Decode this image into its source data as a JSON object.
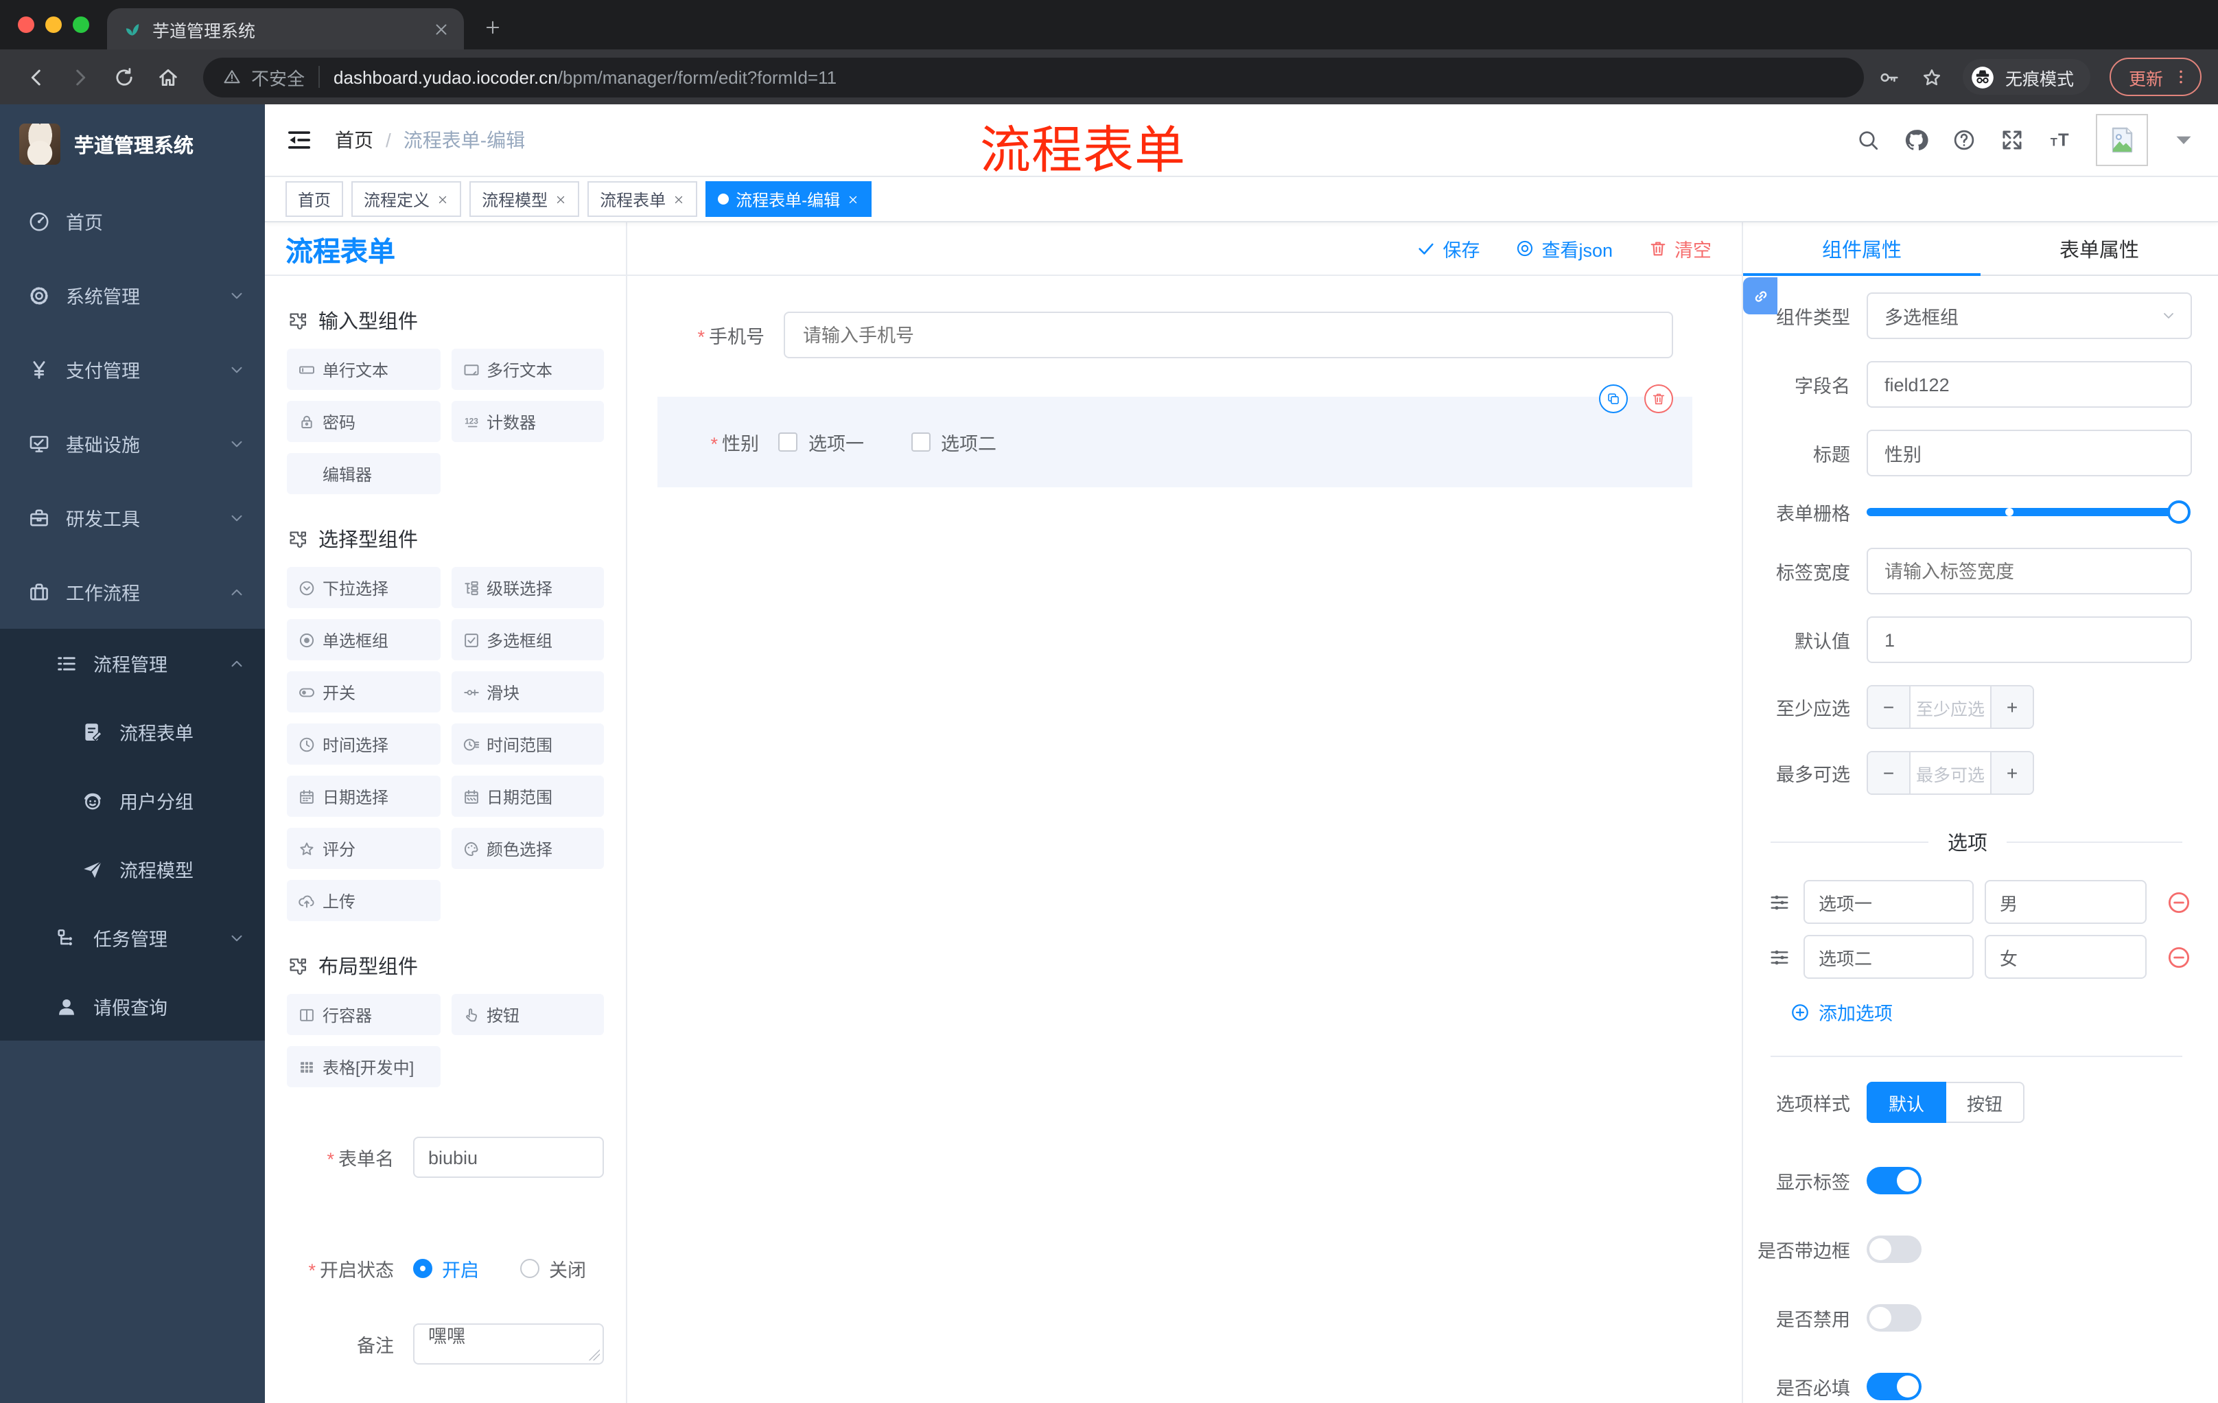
{
  "misc": {
    "asterisk": "*",
    "minus": "−",
    "plus": "+"
  },
  "colors": {
    "accent": "#0e8aff",
    "danger": "#f56c6c",
    "sidebar_bg": "#304156",
    "submenu_bg": "#1f2d3d",
    "annotation_red": "#fe2c0c",
    "active_tag": "#0e8aff"
  },
  "browser": {
    "tab_title": "芋道管理系统",
    "security": "不安全",
    "host": "dashboard.yudao.iocoder.cn",
    "path": "/bpm/manager/form/edit?formId=11",
    "incognito": "无痕模式",
    "update": "更新"
  },
  "sidebar": {
    "logo_title": "芋道管理系统",
    "items": [
      {
        "label": "首页",
        "icon": "dashboard-icon",
        "level": 1,
        "chevron": "",
        "sub": false
      },
      {
        "label": "系统管理",
        "icon": "gear-icon",
        "level": 1,
        "chevron": "down",
        "sub": false
      },
      {
        "label": "支付管理",
        "icon": "yen-icon",
        "level": 1,
        "chevron": "down",
        "sub": false
      },
      {
        "label": "基础设施",
        "icon": "monitor-icon",
        "level": 1,
        "chevron": "down",
        "sub": false
      },
      {
        "label": "研发工具",
        "icon": "briefcase-icon",
        "level": 1,
        "chevron": "down",
        "sub": false
      },
      {
        "label": "工作流程",
        "icon": "suitcase-icon",
        "level": 1,
        "chevron": "up",
        "sub": false
      },
      {
        "label": "流程管理",
        "icon": "list-icon",
        "level": 2,
        "chevron": "up",
        "sub": true
      },
      {
        "label": "流程表单",
        "icon": "doc-edit-icon",
        "level": 3,
        "chevron": "",
        "sub": true
      },
      {
        "label": "用户分组",
        "icon": "robot-icon",
        "level": 3,
        "chevron": "",
        "sub": true
      },
      {
        "label": "流程模型",
        "icon": "plane-icon",
        "level": 3,
        "chevron": "",
        "sub": true
      },
      {
        "label": "任务管理",
        "icon": "org-icon",
        "level": 2,
        "chevron": "down",
        "sub": true
      },
      {
        "label": "请假查询",
        "icon": "person-icon",
        "level": 2,
        "chevron": "",
        "sub": true
      }
    ]
  },
  "header": {
    "breadcrumb_home": "首页",
    "breadcrumb_sep": "/",
    "breadcrumb_current": "流程表单-编辑",
    "annotation": "流程表单"
  },
  "tags": [
    {
      "label": "首页",
      "closable": false,
      "active": false
    },
    {
      "label": "流程定义",
      "closable": true,
      "active": false
    },
    {
      "label": "流程模型",
      "closable": true,
      "active": false
    },
    {
      "label": "流程表单",
      "closable": true,
      "active": false
    },
    {
      "label": "流程表单-编辑",
      "closable": true,
      "active": true
    }
  ],
  "palette": {
    "title": "流程表单",
    "sections": [
      {
        "title": "输入型组件",
        "items": [
          {
            "label": "单行文本",
            "icon": "input-icon"
          },
          {
            "label": "多行文本",
            "icon": "textarea-icon"
          },
          {
            "label": "密码",
            "icon": "lock-icon"
          },
          {
            "label": "计数器",
            "icon": "counter-icon"
          },
          {
            "label": "编辑器",
            "icon": ""
          }
        ]
      },
      {
        "title": "选择型组件",
        "items": [
          {
            "label": "下拉选择",
            "icon": "select-icon"
          },
          {
            "label": "级联选择",
            "icon": "cascade-icon"
          },
          {
            "label": "单选框组",
            "icon": "radio-icon"
          },
          {
            "label": "多选框组",
            "icon": "checkbox-icon"
          },
          {
            "label": "开关",
            "icon": "switch-icon"
          },
          {
            "label": "滑块",
            "icon": "slider-icon"
          },
          {
            "label": "时间选择",
            "icon": "time-icon"
          },
          {
            "label": "时间范围",
            "icon": "time-range-icon"
          },
          {
            "label": "日期选择",
            "icon": "date-icon"
          },
          {
            "label": "日期范围",
            "icon": "date-range-icon"
          },
          {
            "label": "评分",
            "icon": "star-icon"
          },
          {
            "label": "颜色选择",
            "icon": "color-icon"
          },
          {
            "label": "上传",
            "icon": "upload-icon"
          }
        ]
      },
      {
        "title": "布局型组件",
        "items": [
          {
            "label": "行容器",
            "icon": "row-icon"
          },
          {
            "label": "按钮",
            "icon": "button-icon"
          },
          {
            "label": "表格[开发中]",
            "icon": "table-icon"
          }
        ]
      }
    ]
  },
  "left_form": {
    "name_label": "表单名",
    "name_value": "biubiu",
    "status_label": "开启状态",
    "status_on": "开启",
    "status_off": "关闭",
    "remark_label": "备注",
    "remark_value": "嘿嘿"
  },
  "canvas": {
    "save_label": "保存",
    "view_label": "查看json",
    "clear_label": "清空",
    "phone_label": "手机号",
    "phone_placeholder": "请输入手机号",
    "gender_label": "性别",
    "gender_options": [
      "选项一",
      "选项二"
    ]
  },
  "props": {
    "tab_component": "组件属性",
    "tab_form": "表单属性",
    "type_label": "组件类型",
    "type_value": "多选框组",
    "field_label": "字段名",
    "field_value": "field122",
    "title_label": "标题",
    "title_value": "性别",
    "grid_label": "表单栅格",
    "width_label": "标签宽度",
    "width_placeholder": "请输入标签宽度",
    "default_label": "默认值",
    "default_value": "1",
    "min_label": "至少应选",
    "min_placeholder": "至少应选",
    "max_label": "最多可选",
    "max_placeholder": "最多可选",
    "options_title": "选项",
    "options": [
      {
        "label": "选项一",
        "value": "男"
      },
      {
        "label": "选项二",
        "value": "女"
      }
    ],
    "add_option": "添加选项",
    "style_label": "选项样式",
    "style_default": "默认",
    "style_button": "按钮",
    "toggles": [
      {
        "label": "显示标签",
        "on": true
      },
      {
        "label": "是否带边框",
        "on": false
      },
      {
        "label": "是否禁用",
        "on": false
      },
      {
        "label": "是否必填",
        "on": true
      }
    ]
  }
}
